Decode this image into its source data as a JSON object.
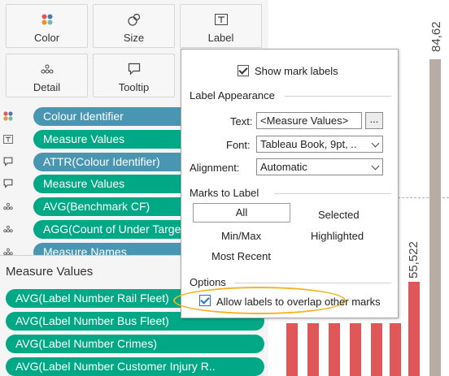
{
  "marks_card": {
    "buttons": [
      {
        "id": "color",
        "label": "Color",
        "icon": "color-dots-icon"
      },
      {
        "id": "size",
        "label": "Size",
        "icon": "size-circles-icon"
      },
      {
        "id": "label",
        "label": "Label",
        "icon": "text-label-icon"
      },
      {
        "id": "detail",
        "label": "Detail",
        "icon": "detail-dots-icon"
      },
      {
        "id": "tooltip",
        "label": "Tooltip",
        "icon": "speech-bubble-icon"
      }
    ],
    "shelf_pills": [
      {
        "text": "Colour Identifier",
        "color": "blue",
        "icon": "color-dots-icon"
      },
      {
        "text": "Measure Values",
        "color": "green",
        "icon": "text-label-icon"
      },
      {
        "text": "ATTR(Colour Identifier)",
        "color": "blue",
        "icon": "speech-bubble-icon"
      },
      {
        "text": "Measure Values",
        "color": "green",
        "icon": "speech-bubble-icon"
      },
      {
        "text": "AVG(Benchmark CF)",
        "color": "green",
        "icon": "detail-dots-icon"
      },
      {
        "text": "AGG(Count of Under Target)",
        "color": "green",
        "icon": "detail-dots-icon"
      },
      {
        "text": "Measure Names",
        "color": "blue",
        "icon": "detail-dots-icon"
      }
    ]
  },
  "measure_values": {
    "title": "Measure Values",
    "pills": [
      "AVG(Label Number Rail Fleet)",
      "AVG(Label Number Bus Fleet)",
      "AVG(Label Number Crimes)",
      "AVG(Label Number Customer Injury R.."
    ]
  },
  "label_popup": {
    "show_mark_labels": "Show mark labels",
    "show_mark_labels_checked": true,
    "label_appearance_heading": "Label Appearance",
    "text_label": "Text:",
    "text_value": "<Measure Values>",
    "ellipsis": "...",
    "font_label": "Font:",
    "font_value": "Tableau Book, 9pt, ..",
    "alignment_label": "Alignment:",
    "alignment_value": "Automatic",
    "marks_to_label_heading": "Marks to Label",
    "mark_options": {
      "all": "All",
      "selected": "Selected",
      "min_max": "Min/Max",
      "highlighted": "Highlighted",
      "most_recent": "Most Recent"
    },
    "options_heading": "Options",
    "allow_overlap": "Allow labels to overlap other marks",
    "allow_overlap_checked": true,
    "highlight_color": "#f3b521"
  },
  "chart": {
    "label_55522": "55,522",
    "label_84623": "84,62",
    "colors": {
      "red": "#e0575a",
      "grey": "#b8ada6"
    }
  }
}
